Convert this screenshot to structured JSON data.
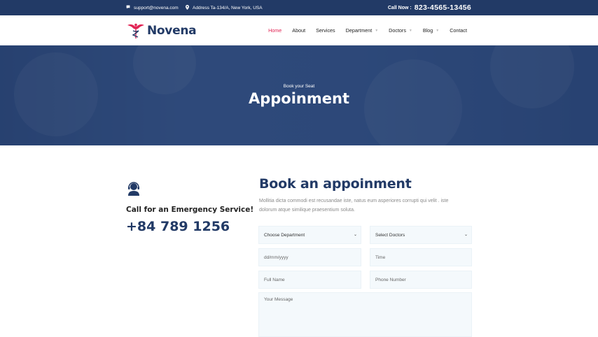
{
  "topbar": {
    "email": "support@novena.com",
    "address": "Address Ta-134/A, New York, USA",
    "call_label": "Call Now :",
    "call_number": "823-4565-13456"
  },
  "nav": {
    "brand": "Novena",
    "items": [
      {
        "label": "Home",
        "active": true,
        "dropdown": false
      },
      {
        "label": "About",
        "active": false,
        "dropdown": false
      },
      {
        "label": "Services",
        "active": false,
        "dropdown": false
      },
      {
        "label": "Department",
        "active": false,
        "dropdown": true
      },
      {
        "label": "Doctors",
        "active": false,
        "dropdown": true
      },
      {
        "label": "Blog",
        "active": false,
        "dropdown": true
      },
      {
        "label": "Contact",
        "active": false,
        "dropdown": false
      }
    ]
  },
  "hero": {
    "kicker": "Book your Seat",
    "title": "Appoinment"
  },
  "emergency": {
    "heading": "Call for an Emergency Service!",
    "phone": "+84 789 1256"
  },
  "booking": {
    "title": "Book an appoinment",
    "description": "Mollitia dicta commodi est recusandae iste, natus eum asperiores corrupti qui velit . iste dolorum atque similique praesentium soluta.",
    "department_select": "Choose Department",
    "doctor_select": "Select Doctors",
    "date_placeholder": "dd/mm/yyyy",
    "time_placeholder": "Time",
    "name_placeholder": "Full Name",
    "phone_placeholder": "Phone Number",
    "message_placeholder": "Your Message"
  },
  "colors": {
    "primary": "#223a66",
    "accent": "#e12454",
    "field_bg": "#f4f9fc"
  }
}
